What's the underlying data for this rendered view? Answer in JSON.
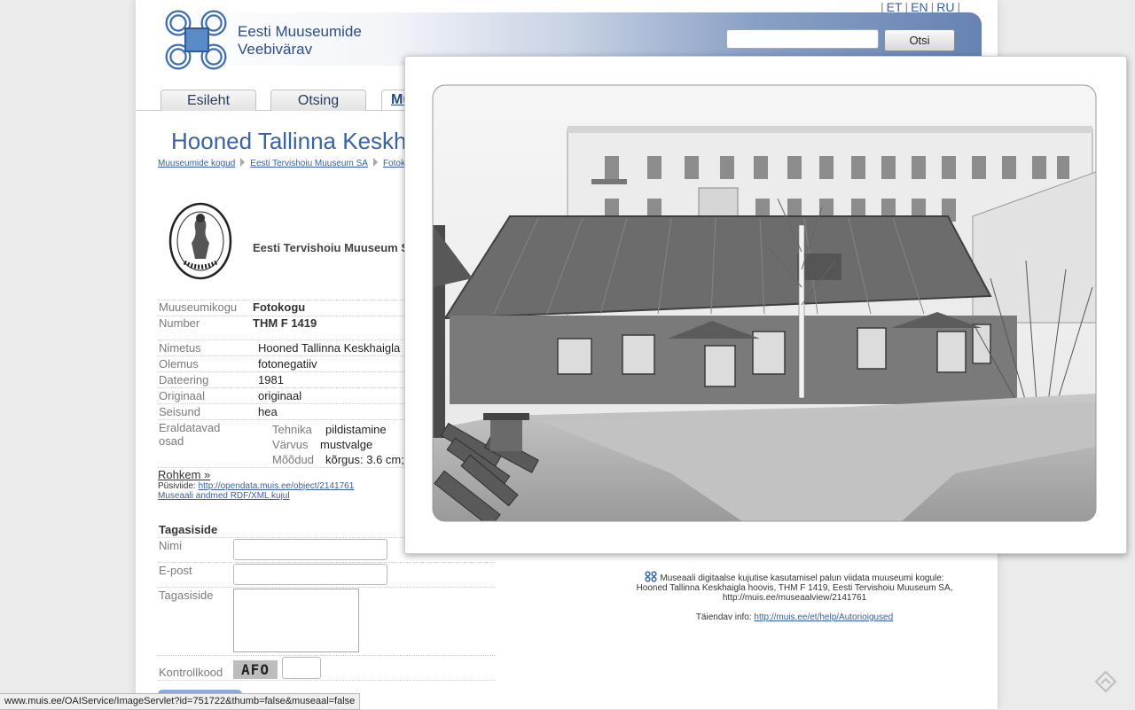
{
  "languages": [
    "ET",
    "EN",
    "RU"
  ],
  "site": {
    "title_line1": "Eesti Muuseumide",
    "title_line2": "Veebivärav"
  },
  "search": {
    "button_label": "Otsi",
    "value": ""
  },
  "tabs": [
    {
      "label": "Esileht"
    },
    {
      "label": "Otsing"
    },
    {
      "label": "Mu"
    }
  ],
  "page_title": "Hooned Tallinna Keskh",
  "breadcrumb": [
    "Muuseumide kogud",
    "Eesti Tervishoiu Muuseum SA",
    "Fotok"
  ],
  "museum": {
    "name": "Eesti Tervishoiu Muuseum S"
  },
  "details": {
    "collection_label": "Muuseumikogu",
    "collection_value": "Fotokogu",
    "number_label": "Number",
    "number_value": "THM F 1419",
    "name_label": "Nimetus",
    "name_value": "Hooned Tallinna Keskhaigla",
    "type_label": "Olemus",
    "type_value": "fotonegatiiv",
    "date_label": "Dateering",
    "date_value": "1981",
    "original_label": "Originaal",
    "original_value": "originaal",
    "condition_label": "Seisund",
    "condition_value": "hea",
    "parts_label_1": "Eraldatavad",
    "parts_label_2": "osad",
    "technique_label": "Tehnika",
    "technique_value": "pildistamine",
    "color_label": "Värvus",
    "color_value": "mustvalge",
    "size_label": "Mõõdud",
    "size_value": "kõrgus: 3.6 cm;"
  },
  "more_link": "Rohkem »",
  "permalink_label": "Püsiviide:",
  "permalink_url": "http://opendata.muis.ee/object/2141761",
  "rdf_link": "Museaali andmed RDF/XML kujul",
  "feedback": {
    "heading": "Tagasiside",
    "name_label": "Nimi",
    "email_label": "E-post",
    "feedback_label": "Tagasiside",
    "captcha_label": "Kontrollkood",
    "captcha_code": "AFO"
  },
  "copyright": {
    "line1": "Museaali digitaalse kujutise kasutamisel palun viidata muuseumi kogule:",
    "line2": "Hooned Tallinna Keskhaigla hoovis, THM F 1419, Eesti Tervishoiu Muuseum SA,",
    "line3": "http://muis.ee/museaalview/2141761",
    "info_label": "Täiendav info:",
    "info_url": "http://muis.ee/et/help/Autorioigused"
  },
  "status_url": "www.muis.ee/OAIService/ImageServlet?id=751722&thumb=false&museaal=false",
  "colors": {
    "brand_blue": "#3a63a3",
    "header_dark": "#6783b3",
    "link": "#3a5f9a"
  }
}
